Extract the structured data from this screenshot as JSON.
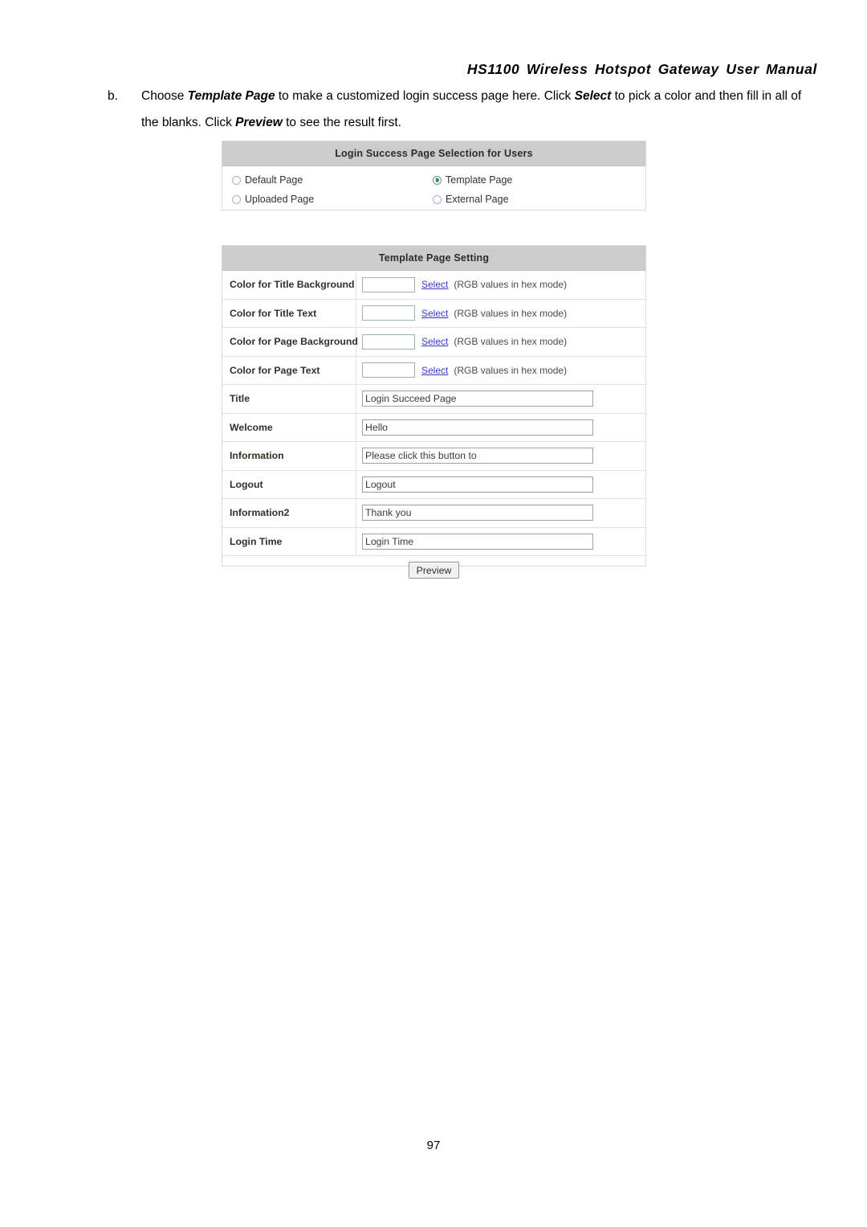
{
  "document": {
    "running_header": "HS1100 Wireless Hotspot Gateway User Manual",
    "page_number": "97",
    "paragraph": {
      "marker": "b.",
      "part1": "Choose ",
      "bold1": "Template Page",
      "part2": " to make a customized login success page here. Click ",
      "bold2": "Select",
      "part3": " to pick a color and then fill in all of the blanks. Click ",
      "bold3": "Preview",
      "part4": " to see the result first."
    }
  },
  "selection_panel": {
    "title": "Login Success Page Selection for Users",
    "options": [
      {
        "label": "Default Page",
        "checked": false
      },
      {
        "label": "Template Page",
        "checked": true
      },
      {
        "label": "Uploaded Page",
        "checked": false
      },
      {
        "label": "External Page",
        "checked": false
      }
    ]
  },
  "setting_panel": {
    "title": "Template Page Setting",
    "select_link_label": "Select",
    "hex_note": "(RGB values in hex mode)",
    "color_rows": [
      {
        "label": "Color for Title Background",
        "value": ""
      },
      {
        "label": "Color for Title Text",
        "value": ""
      },
      {
        "label": "Color for Page Background",
        "value": ""
      },
      {
        "label": "Color for Page Text",
        "value": ""
      }
    ],
    "text_rows": [
      {
        "label": "Title",
        "value": "Login Succeed Page"
      },
      {
        "label": "Welcome",
        "value": "Hello"
      },
      {
        "label": "Information",
        "value": "Please click this button to"
      },
      {
        "label": "Logout",
        "value": "Logout"
      },
      {
        "label": "Information2",
        "value": "Thank you"
      },
      {
        "label": "Login Time",
        "value": "Login Time"
      }
    ],
    "preview_button": "Preview"
  },
  "colors": {
    "panel_header_bg": "#cccccc",
    "link": "#3b38c8",
    "radio_checked_dot": "#1a9b1a",
    "field_border": "#8fa3b8"
  }
}
